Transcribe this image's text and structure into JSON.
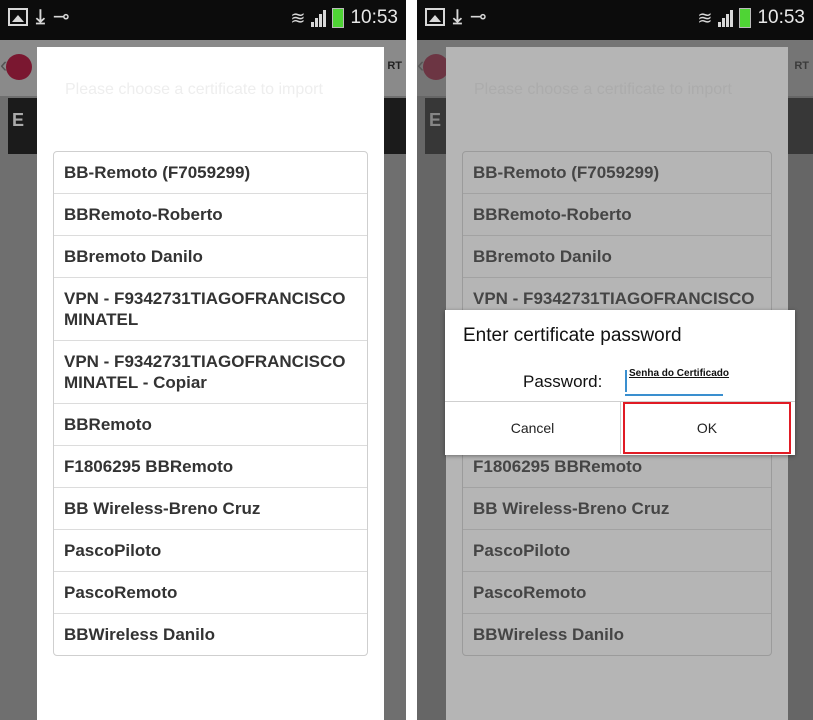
{
  "status_bar": {
    "time": "10:53"
  },
  "background_app": {
    "header_right_fragment": "RT",
    "row_fragment": "E"
  },
  "chooser": {
    "title": "Please choose a certificate to import",
    "items": [
      "BB-Remoto (F7059299)",
      "BBRemoto-Roberto",
      "BBremoto Danilo",
      "VPN - F9342731TIAGOFRANCISCOMINATEL",
      "VPN - F9342731TIAGOFRANCISCOMINATEL - Copiar",
      "BBRemoto",
      "F1806295 BBRemoto",
      "BB Wireless-Breno Cruz",
      "PascoPiloto",
      "PascoRemoto",
      "BBWireless Danilo"
    ]
  },
  "password_dialog": {
    "title": "Enter certificate password",
    "label": "Password:",
    "value": "Senha do Certificado",
    "cancel_label": "Cancel",
    "ok_label": "OK"
  },
  "colors": {
    "battery": "#4fd435",
    "input_underline": "#3a8fcf",
    "highlight_border": "#e01b24",
    "app_logo": "#7a1730"
  },
  "icons": {
    "status_left": [
      "image-icon",
      "download-icon",
      "key-icon"
    ],
    "status_right": [
      "wifi-icon",
      "signal-icon",
      "battery-icon"
    ]
  }
}
